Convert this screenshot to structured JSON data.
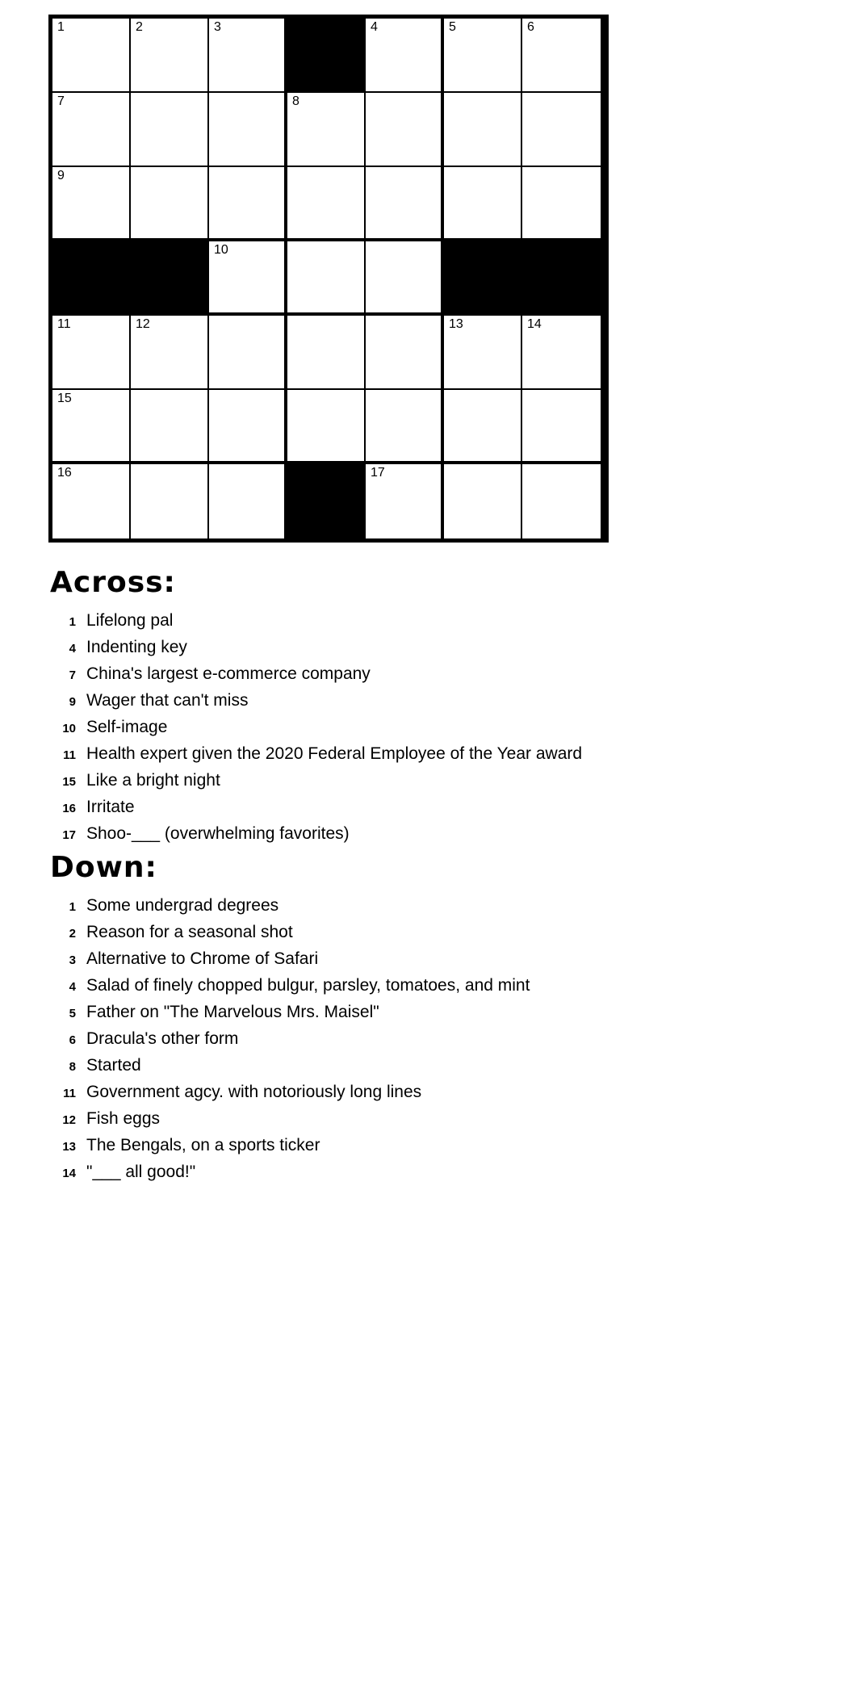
{
  "grid": {
    "rows": 7,
    "cols": 7,
    "cells": [
      [
        {
          "block": false,
          "number": "1"
        },
        {
          "block": false,
          "number": "2"
        },
        {
          "block": false,
          "number": "3"
        },
        {
          "block": true,
          "number": ""
        },
        {
          "block": false,
          "number": "4"
        },
        {
          "block": false,
          "number": "5"
        },
        {
          "block": false,
          "number": "6"
        }
      ],
      [
        {
          "block": false,
          "number": "7"
        },
        {
          "block": false,
          "number": ""
        },
        {
          "block": false,
          "number": ""
        },
        {
          "block": false,
          "number": "8"
        },
        {
          "block": false,
          "number": ""
        },
        {
          "block": false,
          "number": ""
        },
        {
          "block": false,
          "number": ""
        }
      ],
      [
        {
          "block": false,
          "number": "9"
        },
        {
          "block": false,
          "number": ""
        },
        {
          "block": false,
          "number": ""
        },
        {
          "block": false,
          "number": ""
        },
        {
          "block": false,
          "number": ""
        },
        {
          "block": false,
          "number": ""
        },
        {
          "block": false,
          "number": ""
        }
      ],
      [
        {
          "block": true,
          "number": ""
        },
        {
          "block": true,
          "number": ""
        },
        {
          "block": false,
          "number": "10"
        },
        {
          "block": false,
          "number": ""
        },
        {
          "block": false,
          "number": ""
        },
        {
          "block": true,
          "number": ""
        },
        {
          "block": true,
          "number": ""
        }
      ],
      [
        {
          "block": false,
          "number": "11"
        },
        {
          "block": false,
          "number": "12"
        },
        {
          "block": false,
          "number": ""
        },
        {
          "block": false,
          "number": ""
        },
        {
          "block": false,
          "number": ""
        },
        {
          "block": false,
          "number": "13"
        },
        {
          "block": false,
          "number": "14"
        }
      ],
      [
        {
          "block": false,
          "number": "15"
        },
        {
          "block": false,
          "number": ""
        },
        {
          "block": false,
          "number": ""
        },
        {
          "block": false,
          "number": ""
        },
        {
          "block": false,
          "number": ""
        },
        {
          "block": false,
          "number": ""
        },
        {
          "block": false,
          "number": ""
        }
      ],
      [
        {
          "block": false,
          "number": "16"
        },
        {
          "block": false,
          "number": ""
        },
        {
          "block": false,
          "number": ""
        },
        {
          "block": true,
          "number": ""
        },
        {
          "block": false,
          "number": "17"
        },
        {
          "block": false,
          "number": ""
        },
        {
          "block": false,
          "number": ""
        }
      ]
    ]
  },
  "across": {
    "heading": "Across:",
    "clues": [
      {
        "number": "1",
        "text": "Lifelong pal"
      },
      {
        "number": "4",
        "text": "Indenting key"
      },
      {
        "number": "7",
        "text": "China's largest e-commerce company"
      },
      {
        "number": "9",
        "text": "Wager that can't miss"
      },
      {
        "number": "10",
        "text": "Self-image"
      },
      {
        "number": "11",
        "text": "Health expert given the 2020 Federal Employee of the Year award"
      },
      {
        "number": "15",
        "text": "Like a bright night"
      },
      {
        "number": "16",
        "text": "Irritate"
      },
      {
        "number": "17",
        "text": "Shoo-___ (overwhelming favorites)"
      }
    ]
  },
  "down": {
    "heading": "Down:",
    "clues": [
      {
        "number": "1",
        "text": "Some undergrad degrees"
      },
      {
        "number": "2",
        "text": "Reason for a seasonal shot"
      },
      {
        "number": "3",
        "text": "Alternative to Chrome of Safari"
      },
      {
        "number": "4",
        "text": "Salad of finely chopped bulgur, parsley, tomatoes, and mint"
      },
      {
        "number": "5",
        "text": "Father on \"The Marvelous Mrs. Maisel\""
      },
      {
        "number": "6",
        "text": "Dracula's other form"
      },
      {
        "number": "8",
        "text": "Started"
      },
      {
        "number": "11",
        "text": "Government agcy. with notoriously long lines"
      },
      {
        "number": "12",
        "text": "Fish eggs"
      },
      {
        "number": "13",
        "text": "The Bengals, on a sports ticker"
      },
      {
        "number": "14",
        "text": "\"___ all good!\""
      }
    ]
  }
}
